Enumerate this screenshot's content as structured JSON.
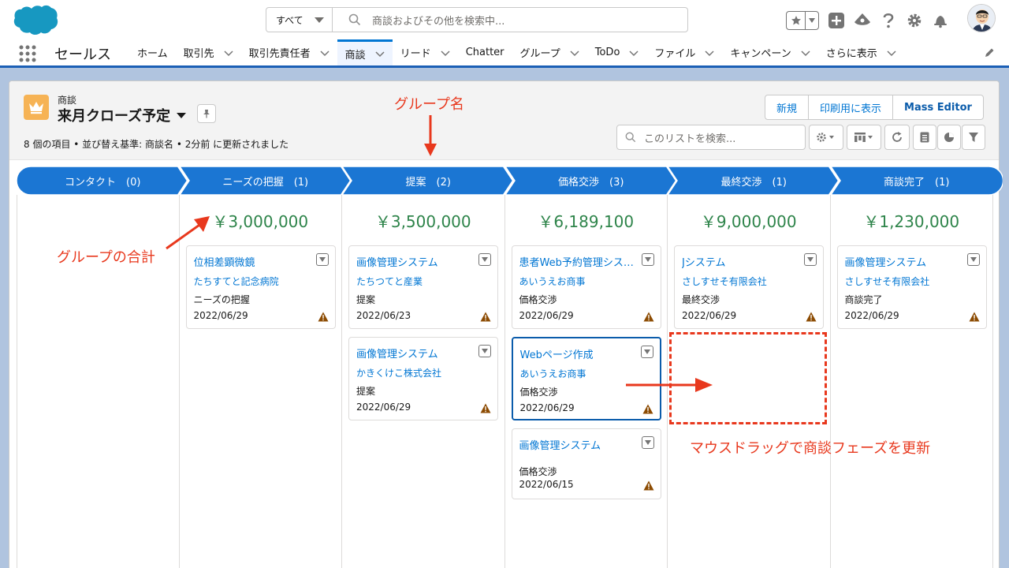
{
  "header": {
    "search_scope": "すべて",
    "search_placeholder": "商談およびその他を検索中...",
    "icons": [
      "favorites-star-icon",
      "add-icon",
      "trailhead-icon",
      "help-icon",
      "setup-gear-icon",
      "notification-bell-icon"
    ]
  },
  "nav": {
    "app_name": "セールス",
    "items": [
      {
        "label": "ホーム",
        "chevron": false,
        "active": false
      },
      {
        "label": "取引先",
        "chevron": true,
        "active": false
      },
      {
        "label": "取引先責任者",
        "chevron": true,
        "active": false
      },
      {
        "label": "商談",
        "chevron": true,
        "active": true
      },
      {
        "label": "リード",
        "chevron": true,
        "active": false
      },
      {
        "label": "Chatter",
        "chevron": false,
        "active": false
      },
      {
        "label": "グループ",
        "chevron": true,
        "active": false
      },
      {
        "label": "ToDo",
        "chevron": true,
        "active": false
      },
      {
        "label": "ファイル",
        "chevron": true,
        "active": false
      },
      {
        "label": "キャンペーン",
        "chevron": true,
        "active": false
      },
      {
        "label": "さらに表示",
        "chevron": true,
        "active": false
      }
    ]
  },
  "list_header": {
    "object_name": "商談",
    "list_view_name": "来月クローズ予定",
    "meta": "8 個の項目 • 並び替え基準: 商談名 • 2分前 に更新されました",
    "buttons": [
      "新規",
      "印刷用に表示",
      "Mass Editor"
    ],
    "list_search_placeholder": "このリストを検索..."
  },
  "stages": [
    {
      "label": "コンタクト　(0)",
      "total": "",
      "cards": []
    },
    {
      "label": "ニーズの把握　(1)",
      "total": "￥3,000,000",
      "cards": [
        {
          "name": "位相差顕微鏡",
          "account": "たちすてと記念病院",
          "stage": "ニーズの把握",
          "date": "2022/06/29",
          "selected": false
        }
      ]
    },
    {
      "label": "提案　(2)",
      "total": "￥3,500,000",
      "cards": [
        {
          "name": "画像管理システム",
          "account": "たちつてと産業",
          "stage": "提案",
          "date": "2022/06/23",
          "selected": false
        },
        {
          "name": "画像管理システム",
          "account": "かきくけこ株式会社",
          "stage": "提案",
          "date": "2022/06/29",
          "selected": false
        }
      ]
    },
    {
      "label": "価格交渉　(3)",
      "total": "￥6,189,100",
      "cards": [
        {
          "name": "患者Web予約管理システム",
          "account": "あいうえお商事",
          "stage": "価格交渉",
          "date": "2022/06/29",
          "selected": false
        },
        {
          "name": "Webページ作成",
          "account": "あいうえお商事",
          "stage": "価格交渉",
          "date": "2022/06/29",
          "selected": true
        },
        {
          "name": "画像管理システム",
          "account": "",
          "stage": "価格交渉",
          "date": "2022/06/15",
          "selected": false
        }
      ]
    },
    {
      "label": "最終交渉　(1)",
      "total": "￥9,000,000",
      "cards": [
        {
          "name": "Jシステム",
          "account": "さしすせそ有限会社",
          "stage": "最終交渉",
          "date": "2022/06/29",
          "selected": false
        }
      ]
    },
    {
      "label": "商談完了　(1)",
      "total": "￥1,230,000",
      "cards": [
        {
          "name": "画像管理システム",
          "account": "さしすせそ有限会社",
          "stage": "商談完了",
          "date": "2022/06/29",
          "selected": false
        }
      ]
    }
  ],
  "annotations": {
    "group_name": "グループ名",
    "group_total": "グループの合計",
    "drag_hint": "マウスドラッグで商談フェーズを更新"
  },
  "colors": {
    "path_blue": "#1b76d3",
    "total_green": "#2e844a",
    "annotation_red": "#e8381d",
    "link_blue": "#0176d3"
  }
}
